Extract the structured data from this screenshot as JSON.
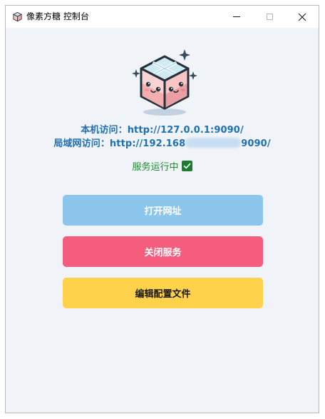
{
  "window": {
    "title": "像素方糖 控制台"
  },
  "info": {
    "local_url": "本机访问：http://127.0.0.1:9090/",
    "lan_prefix": "局域网访问：http://192.168",
    "lan_suffix": "9090/"
  },
  "status": {
    "text": "服务运行中",
    "ok": true
  },
  "buttons": {
    "open_url": "打开网址",
    "stop_service": "关闭服务",
    "edit_config": "编辑配置文件"
  },
  "colors": {
    "link": "#1f6fb3",
    "status_green": "#1e8b2c",
    "btn_open": "#8dc6ec",
    "btn_close": "#f55d7e",
    "btn_edit": "#ffd24c",
    "background": "#f0f4f9"
  },
  "icons": {
    "app": "sugar-cube-icon",
    "mascot": "sugar-cube-mascot",
    "status": "checkbox-checked-icon"
  }
}
